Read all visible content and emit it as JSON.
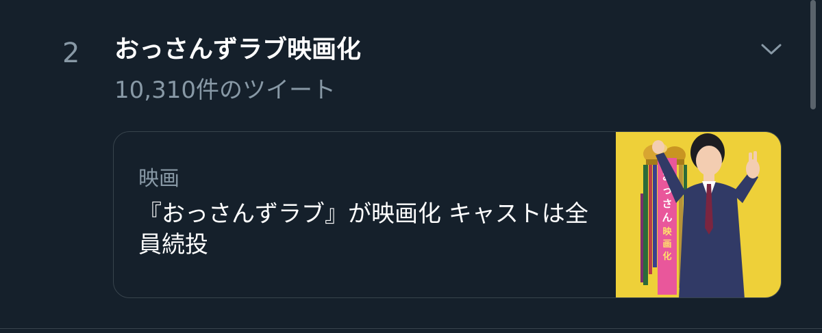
{
  "trend": {
    "rank": "2",
    "title": "おっさんずラブ映画化",
    "tweet_count": "10,310件のツイート"
  },
  "news_card": {
    "category": "映画",
    "headline": "『おっさんずラブ』が映画化 キャストは全員続投",
    "thumbnail_banner_text": "おっさんずラブ映画化だお"
  },
  "icons": {
    "expand": "chevron-down-icon"
  },
  "colors": {
    "background": "#15202b",
    "primary_text": "#ffffff",
    "secondary_text": "#8899a6",
    "border": "#38444d",
    "thumbnail_bg": "#f1d43c"
  }
}
